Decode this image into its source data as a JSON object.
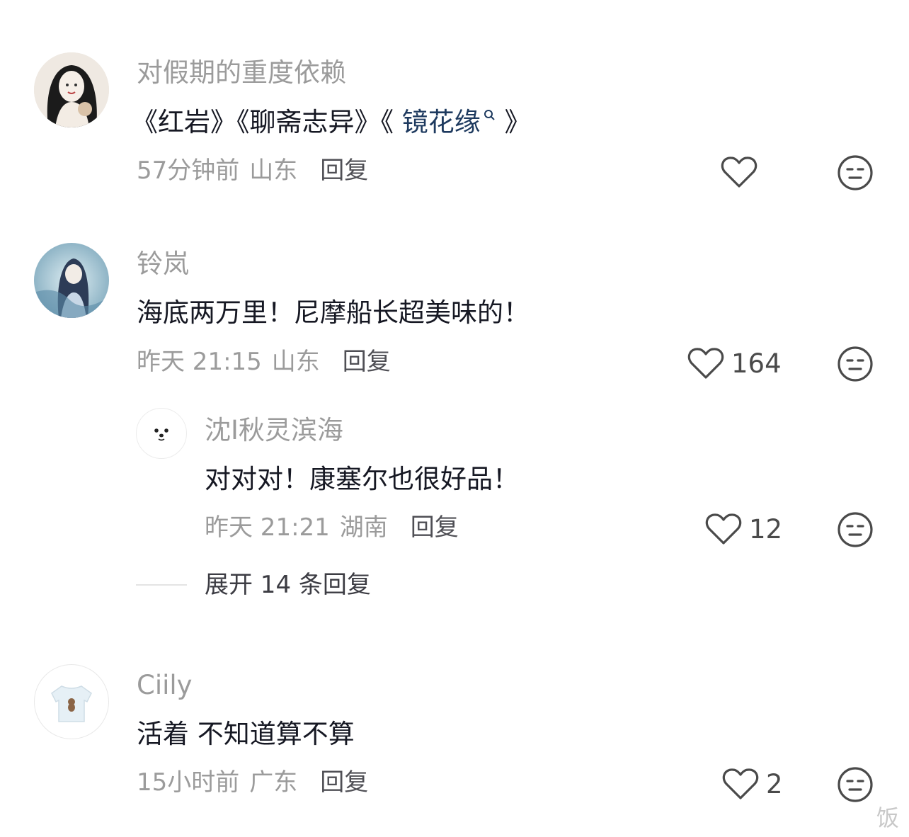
{
  "comments": [
    {
      "username": "对假期的重度依赖",
      "content_prefix": "《红岩》《聊斋志异》《 ",
      "content_link": "镜花缘",
      "content_suffix": " 》",
      "time": "57分钟前",
      "location": "山东",
      "reply_label": "回复",
      "like_count": "",
      "avatar_icon": "girl-avatar-icon"
    },
    {
      "username": "铃岚",
      "content": "海底两万里！尼摩船长超美味的！",
      "time": "昨天 21:15",
      "location": "山东",
      "reply_label": "回复",
      "like_count": "164",
      "avatar_icon": "anime-avatar-icon",
      "replies": [
        {
          "username": "沈I秋灵滨海",
          "content": "对对对！康塞尔也很好品！",
          "time": "昨天 21:21",
          "location": "湖南",
          "reply_label": "回复",
          "like_count": "12"
        }
      ],
      "expand_label": "展开 14 条回复"
    },
    {
      "username": "Ciily",
      "content": "活着 不知道算不算",
      "time": "15小时前",
      "location": "广东",
      "reply_label": "回复",
      "like_count": "2",
      "avatar_icon": "bear-shirt-avatar-icon"
    }
  ],
  "watermark": "饭",
  "colors": {
    "username": "#9b9b9b",
    "content": "#161823",
    "link": "#1e3a5f",
    "icon": "#4a4a4a"
  }
}
